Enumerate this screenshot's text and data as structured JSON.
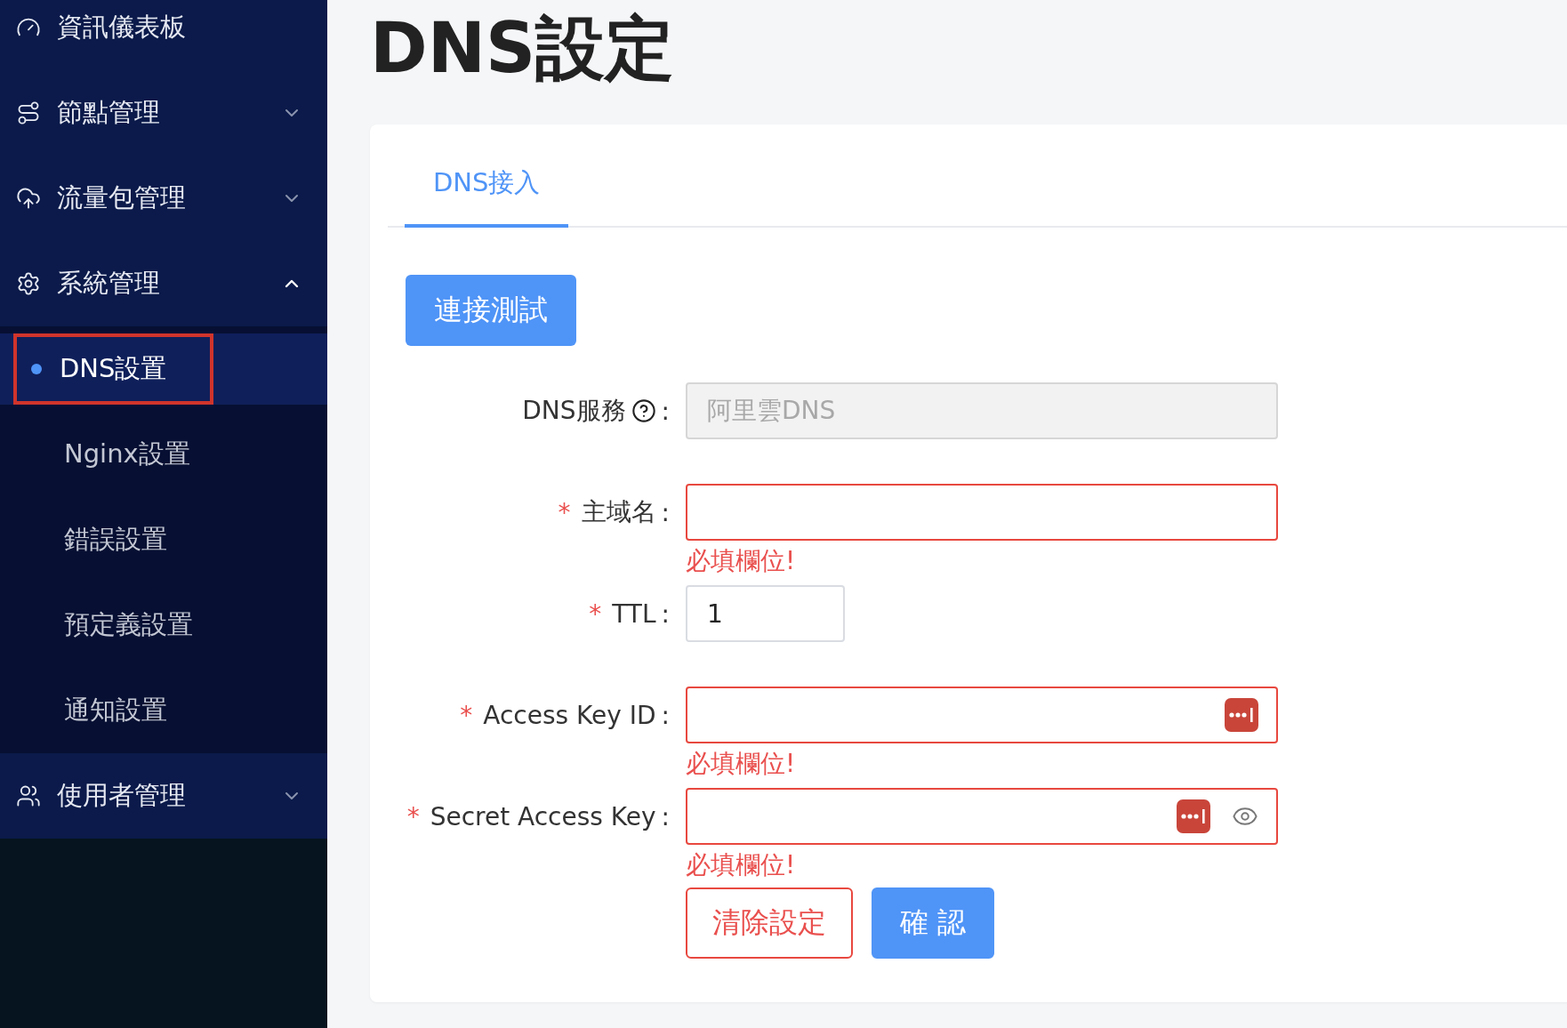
{
  "sidebar": {
    "items": [
      {
        "label": "資訊儀表板",
        "kind": "link"
      },
      {
        "label": "節點管理",
        "kind": "group",
        "expanded": false
      },
      {
        "label": "流量包管理",
        "kind": "group",
        "expanded": false
      },
      {
        "label": "系統管理",
        "kind": "group",
        "expanded": true,
        "children": [
          {
            "label": "DNS設置",
            "selected": true,
            "outlined": true
          },
          {
            "label": "Nginx設置",
            "selected": false,
            "outlined": false
          },
          {
            "label": "錯誤設置",
            "selected": false,
            "outlined": false
          },
          {
            "label": "預定義設置",
            "selected": false,
            "outlined": false
          },
          {
            "label": "通知設置",
            "selected": false,
            "outlined": false
          }
        ]
      },
      {
        "label": "使用者管理",
        "kind": "group",
        "expanded": false
      }
    ]
  },
  "page_title": "DNS設定",
  "tabs": [
    {
      "label": "DNS接入",
      "selected": true
    }
  ],
  "test_button": "連接測試",
  "required_mark": "*",
  "form": {
    "fields": [
      {
        "label": "DNS服務",
        "colon": ":",
        "kind": "text",
        "required": false,
        "help": true,
        "disabled": true,
        "value": "阿里雲DNS"
      },
      {
        "label": "主域名",
        "colon": ":",
        "kind": "text",
        "required": true,
        "help": false,
        "disabled": false,
        "error": "必填欄位!"
      },
      {
        "label": "TTL",
        "colon": ":",
        "kind": "number",
        "required": true,
        "help": false,
        "disabled": false,
        "value": "1"
      },
      {
        "label": "Access Key ID",
        "colon": ":",
        "kind": "password",
        "required": true,
        "help": false,
        "disabled": false,
        "reveal_toggle": false,
        "error": "必填欄位!"
      },
      {
        "label": "Secret Access Key",
        "colon": ":",
        "kind": "password",
        "required": true,
        "help": false,
        "disabled": false,
        "reveal_toggle": true,
        "error": "必填欄位!"
      }
    ],
    "actions": [
      {
        "label": "清除設定",
        "kind": "outline"
      },
      {
        "label": "確 認",
        "kind": "primary"
      }
    ]
  }
}
